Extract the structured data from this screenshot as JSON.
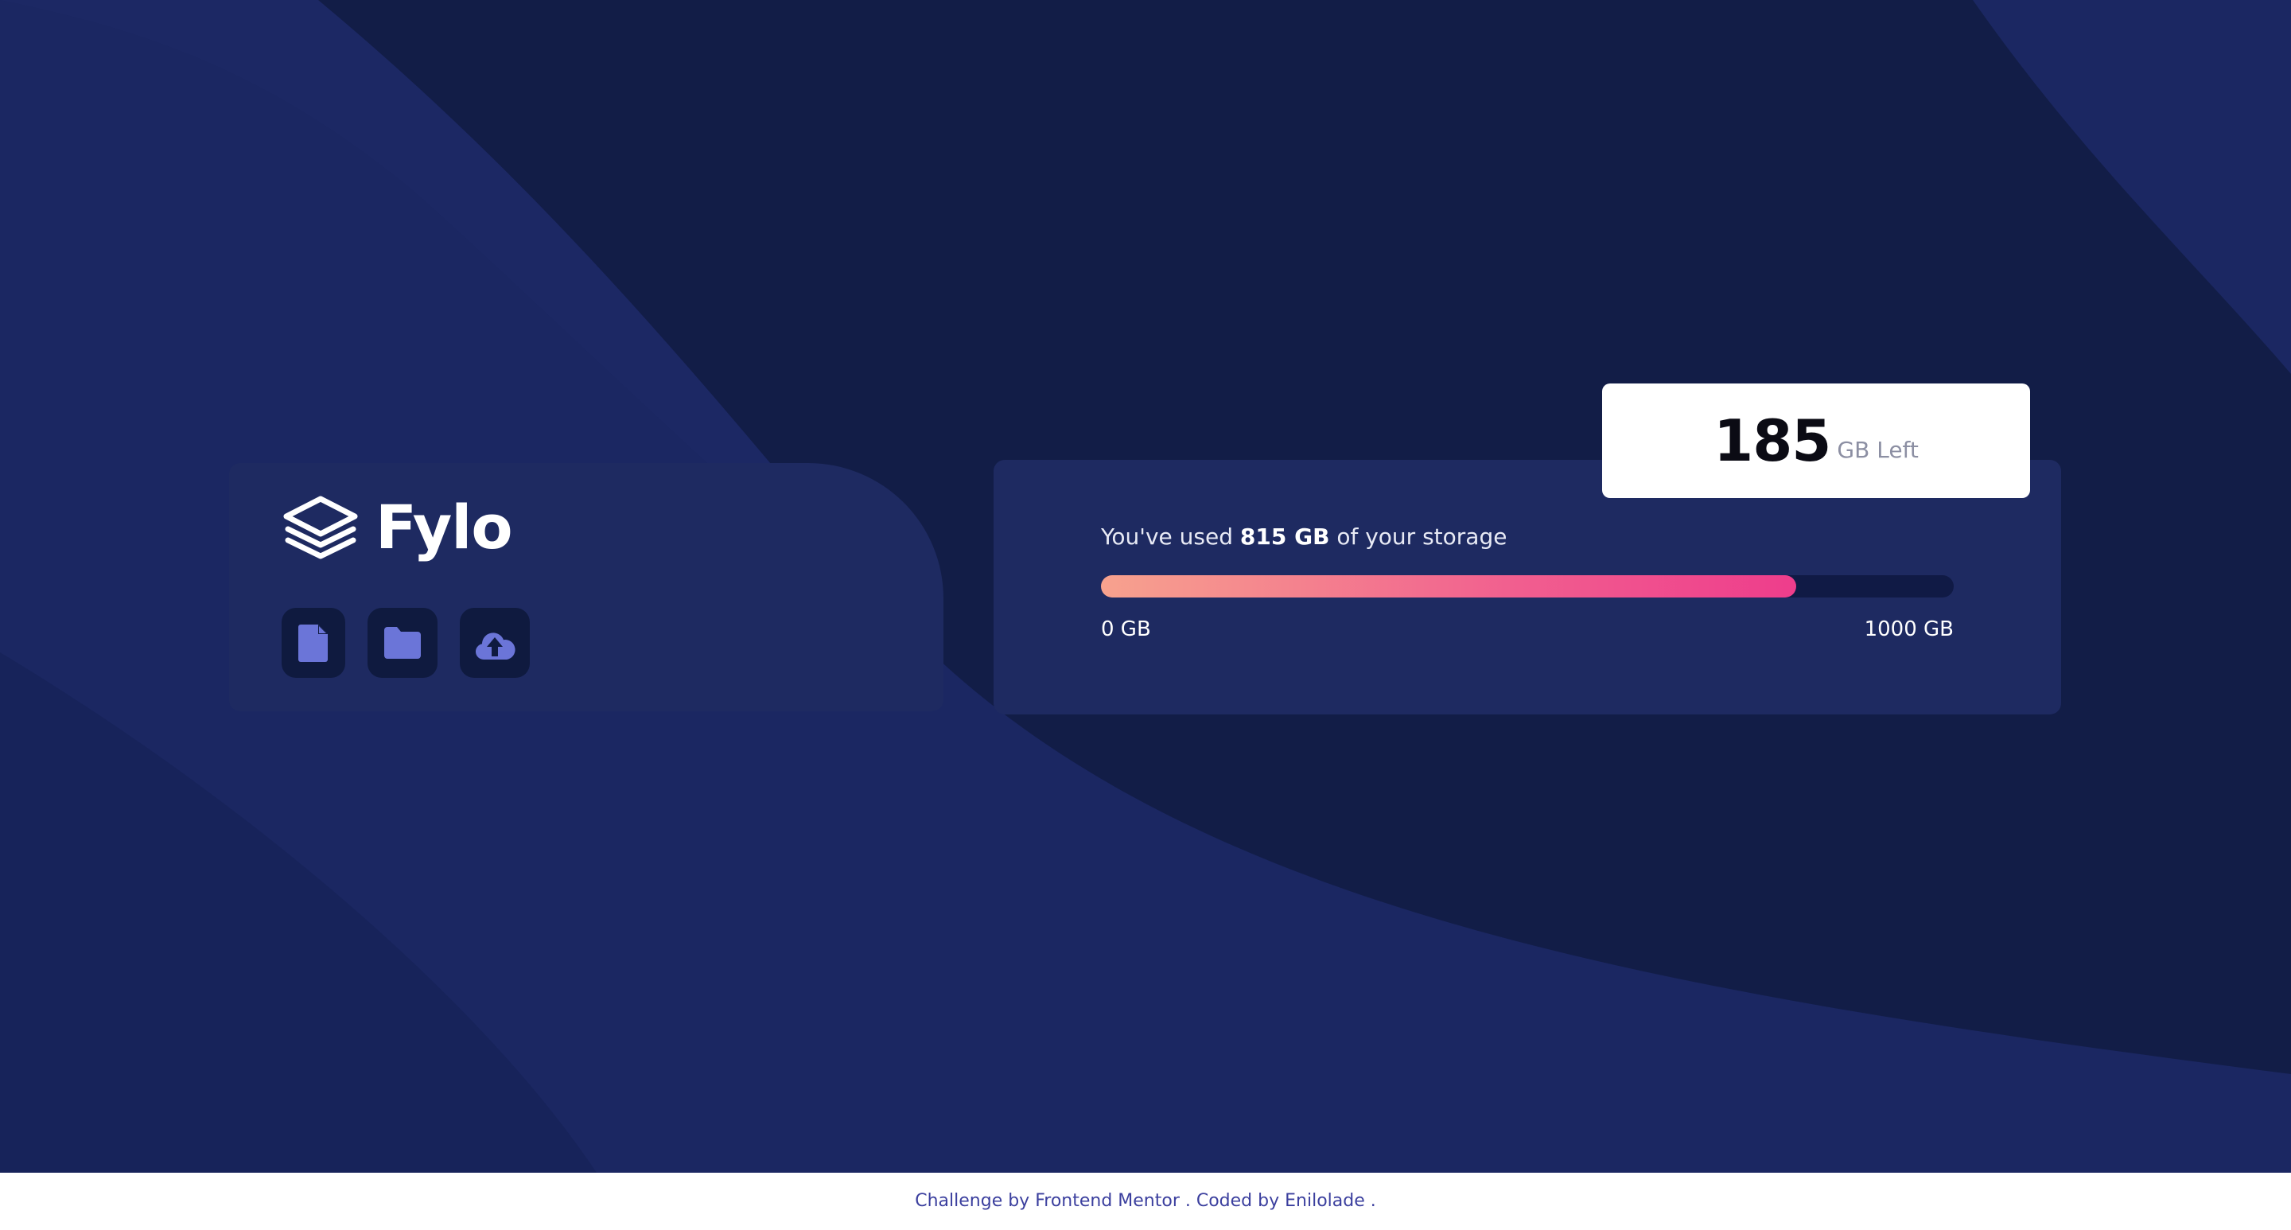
{
  "brand": {
    "name": "Fylo",
    "logo_icon": "layers-icon"
  },
  "actions": [
    {
      "icon": "document-icon"
    },
    {
      "icon": "folder-icon"
    },
    {
      "icon": "upload-icon"
    }
  ],
  "storage": {
    "used_prefix": "You've used ",
    "used_value": "815 GB",
    "used_suffix": " of your storage",
    "used_fraction": 0.815,
    "min_label": "0 GB",
    "max_label": "1000 GB",
    "remaining_value": "185",
    "remaining_unit": "GB Left"
  },
  "footer": {
    "prefix": "Challenge by ",
    "challenge_link": "Frontend Mentor",
    "middle": " . Coded by ",
    "author_link": "Enilolade",
    "suffix": " ."
  },
  "colors": {
    "background": "#131f4a",
    "card": "#1e2a61",
    "icon_bg": "#0f1a3f",
    "icon_fg": "#6b75d8",
    "bar_start": "#f7a28e",
    "bar_end": "#ee3d8c"
  }
}
